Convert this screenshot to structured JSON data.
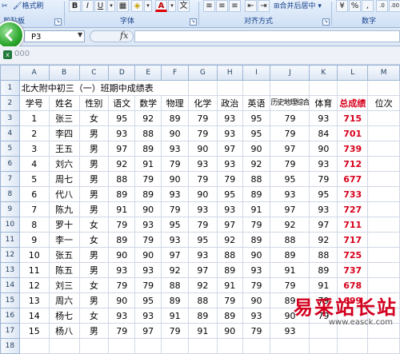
{
  "ribbon": {
    "groups": [
      {
        "label": "剪贴板"
      },
      {
        "label": "字体"
      },
      {
        "label": "对齐方式"
      },
      {
        "label": "数字"
      }
    ],
    "format_painter_label": "格式刷",
    "bold_label": "B",
    "italic_label": "I",
    "underline_label": "U",
    "font_color_label": "A",
    "merge_center_label": "合并后居中",
    "percent_label": "%",
    "comma_label": ","
  },
  "formula_bar": {
    "name_box": "P3",
    "fx_label": "fx",
    "formula": ""
  },
  "workbook": {
    "name": "000"
  },
  "sheet": {
    "columns": [
      "A",
      "B",
      "C",
      "D",
      "E",
      "F",
      "G",
      "H",
      "I",
      "J",
      "K",
      "L",
      "M"
    ],
    "row_numbers": [
      "1",
      "2",
      "3",
      "4",
      "5",
      "6",
      "7",
      "8",
      "9",
      "10",
      "11",
      "12",
      "13",
      "14",
      "15",
      "16",
      "17",
      "18"
    ],
    "title": "北大附中初三（一）班期中成绩表",
    "headers": [
      "学号",
      "姓名",
      "性别",
      "语文",
      "数学",
      "物理",
      "化学",
      "政治",
      "英语",
      "历史地理综合",
      "体育",
      "总成绩",
      "位次"
    ],
    "rows": [
      [
        "1",
        "张三",
        "女",
        "95",
        "92",
        "89",
        "79",
        "93",
        "95",
        "79",
        "93",
        "715",
        ""
      ],
      [
        "2",
        "李四",
        "男",
        "93",
        "88",
        "90",
        "79",
        "93",
        "95",
        "79",
        "84",
        "701",
        ""
      ],
      [
        "3",
        "王五",
        "男",
        "97",
        "89",
        "93",
        "90",
        "97",
        "90",
        "97",
        "90",
        "739",
        ""
      ],
      [
        "4",
        "刘六",
        "男",
        "92",
        "91",
        "79",
        "93",
        "93",
        "92",
        "79",
        "93",
        "712",
        ""
      ],
      [
        "5",
        "周七",
        "男",
        "88",
        "79",
        "90",
        "79",
        "79",
        "88",
        "95",
        "79",
        "677",
        ""
      ],
      [
        "6",
        "代八",
        "男",
        "89",
        "89",
        "93",
        "90",
        "95",
        "89",
        "93",
        "95",
        "733",
        ""
      ],
      [
        "7",
        "陈九",
        "男",
        "91",
        "90",
        "79",
        "93",
        "93",
        "91",
        "97",
        "93",
        "727",
        ""
      ],
      [
        "8",
        "罗十",
        "女",
        "79",
        "93",
        "95",
        "79",
        "97",
        "79",
        "92",
        "97",
        "711",
        ""
      ],
      [
        "9",
        "李一",
        "女",
        "89",
        "79",
        "93",
        "95",
        "92",
        "89",
        "88",
        "92",
        "717",
        ""
      ],
      [
        "10",
        "张五",
        "男",
        "90",
        "90",
        "97",
        "93",
        "88",
        "90",
        "89",
        "88",
        "725",
        ""
      ],
      [
        "11",
        "陈五",
        "男",
        "93",
        "93",
        "92",
        "97",
        "89",
        "93",
        "91",
        "89",
        "737",
        ""
      ],
      [
        "12",
        "刘三",
        "女",
        "79",
        "79",
        "88",
        "92",
        "91",
        "79",
        "79",
        "91",
        "678",
        ""
      ],
      [
        "13",
        "周六",
        "男",
        "90",
        "95",
        "89",
        "88",
        "79",
        "90",
        "89",
        "79",
        "699",
        ""
      ],
      [
        "14",
        "杨七",
        "女",
        "93",
        "93",
        "91",
        "89",
        "89",
        "93",
        "90",
        "79",
        "",
        ""
      ],
      [
        "15",
        "杨八",
        "男",
        "79",
        "97",
        "79",
        "91",
        "90",
        "79",
        "93",
        "",
        "",
        " "
      ],
      [
        "",
        "",
        "",
        "",
        "",
        "",
        "",
        "",
        "",
        "",
        "",
        "",
        ""
      ]
    ]
  },
  "watermark": {
    "text": "易采站长站",
    "url": "www.easck.com"
  }
}
